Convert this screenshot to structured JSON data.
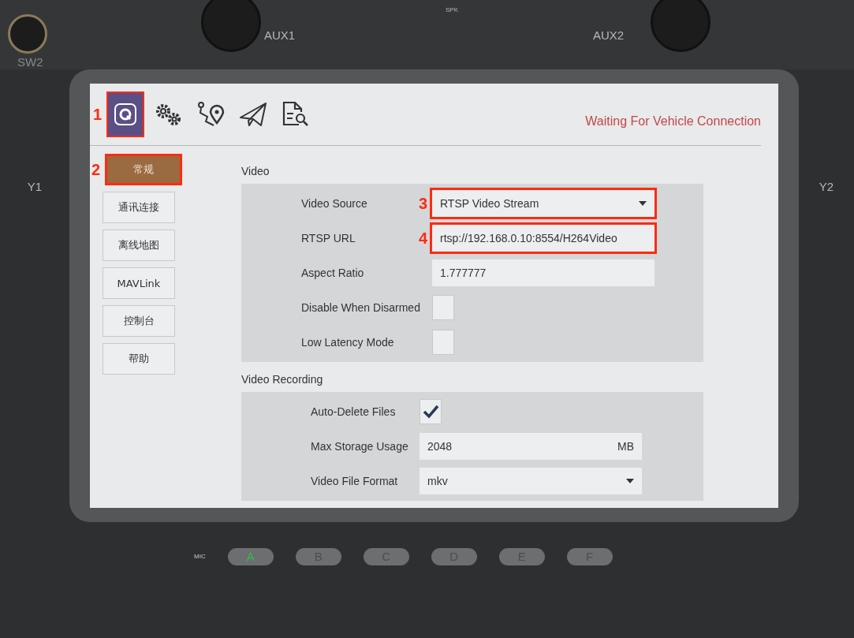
{
  "hardware": {
    "sw2": "SW2",
    "aux1": "AUX1",
    "spk": "SPK",
    "aux2": "AUX2",
    "y1": "Y1",
    "y2": "Y2",
    "mic": "MIC",
    "keys": [
      {
        "label": "A",
        "lit": true
      },
      {
        "label": "B",
        "lit": false
      },
      {
        "label": "C",
        "lit": false
      },
      {
        "label": "D",
        "lit": false
      },
      {
        "label": "E",
        "lit": false
      },
      {
        "label": "F",
        "lit": false
      }
    ]
  },
  "toolbar": {
    "icons": [
      {
        "kind": "app",
        "selected": true,
        "callout": "1"
      },
      {
        "kind": "gears",
        "selected": false
      },
      {
        "kind": "route",
        "selected": false
      },
      {
        "kind": "plane",
        "selected": false
      },
      {
        "kind": "analyze",
        "selected": false
      }
    ],
    "status": "Waiting For Vehicle Connection"
  },
  "sidebar": {
    "items": [
      {
        "label": "常规",
        "selected": true,
        "callout": "2"
      },
      {
        "label": "通讯连接",
        "selected": false
      },
      {
        "label": "离线地图",
        "selected": false
      },
      {
        "label": "MAVLink",
        "selected": false
      },
      {
        "label": "控制台",
        "selected": false
      },
      {
        "label": "帮助",
        "selected": false
      }
    ]
  },
  "video": {
    "title": "Video",
    "rows": [
      {
        "kind": "dropdown",
        "label": "Video Source",
        "value": "RTSP Video Stream",
        "callout": "3"
      },
      {
        "kind": "text",
        "label": "RTSP URL",
        "value": "rtsp://192.168.0.10:8554/H264Video",
        "callout": "4"
      },
      {
        "kind": "text",
        "label": "Aspect Ratio",
        "value": "1.777777"
      },
      {
        "kind": "checkbox",
        "label": "Disable When Disarmed",
        "checked": false
      },
      {
        "kind": "checkbox",
        "label": "Low Latency Mode",
        "checked": false
      }
    ]
  },
  "video_recording": {
    "title": "Video Recording",
    "rows": [
      {
        "kind": "checkbox",
        "label": "Auto-Delete Files",
        "checked": true
      },
      {
        "kind": "text",
        "label": "Max Storage Usage",
        "value": "2048",
        "unit": "MB"
      },
      {
        "kind": "dropdown",
        "label": "Video File Format",
        "value": "mkv"
      }
    ]
  }
}
